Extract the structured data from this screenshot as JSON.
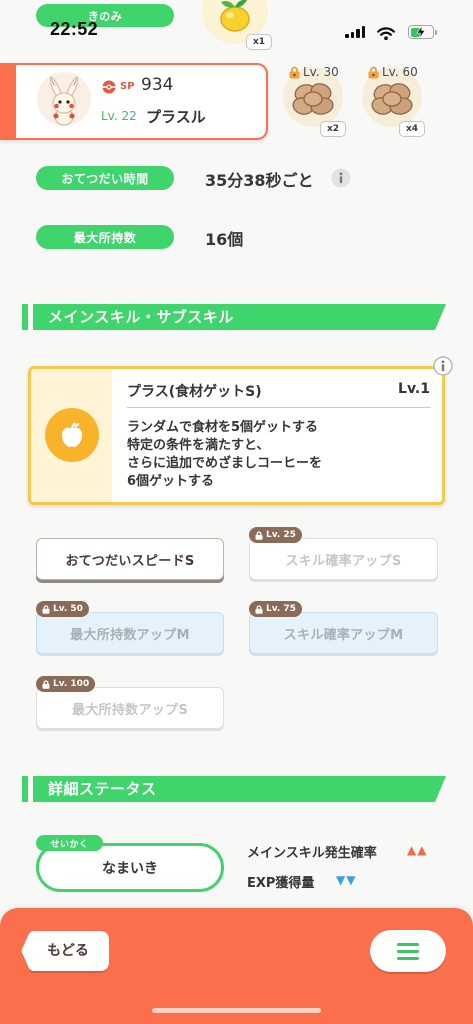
{
  "colors": {
    "green": "#3fd46c",
    "coral": "#fb6f4c",
    "skill_border": "#f5c84a",
    "lock_tag": "#8b6a57",
    "up_arrow": "#f26b46",
    "down_arrow": "#3aa0e6",
    "level_green": "#3dbd60"
  },
  "status_bar": {
    "time": "22:52",
    "signal_bars": 4,
    "wifi_icon": "wifi-icon",
    "battery": {
      "level": 0.45,
      "charging": true
    }
  },
  "berry": {
    "label": "きのみ",
    "icon": "berry-icon",
    "count": "x1"
  },
  "pokemon": {
    "avatar_icon": "pokemon-avatar-icon",
    "sp_label": "SP",
    "sp_value": "934",
    "level": "Lv. 22",
    "name": "プラスル"
  },
  "ingredients": [
    {
      "unlock_level": "Lv. 30",
      "count": "x2",
      "icon": "ingredient-icon"
    },
    {
      "unlock_level": "Lv. 60",
      "count": "x4",
      "icon": "ingredient-icon"
    }
  ],
  "stats": [
    {
      "label": "おてつだい時間",
      "value": "35分38秒ごと"
    },
    {
      "label": "最大所持数",
      "value": "16個"
    }
  ],
  "skills_section": {
    "title": "メインスキル・サブスキル",
    "main_skill": {
      "name": "プラス(食材ゲットS)",
      "level": "Lv.1",
      "icon": "apple-icon",
      "description": [
        "ランダムで食材を5個ゲットする",
        "特定の条件を満たすと、",
        "さらに追加でめざましコーヒーを",
        "6個ゲットする"
      ]
    },
    "sub_skills": [
      {
        "name": "おてつだいスピードS"
      },
      {
        "name": "スキル確率アップS",
        "unlock_level": "Lv. 25"
      },
      {
        "name": "最大所持数アップM",
        "unlock_level": "Lv. 50"
      },
      {
        "name": "スキル確率アップM",
        "unlock_level": "Lv. 75"
      },
      {
        "name": "最大所持数アップS",
        "unlock_level": "Lv. 100"
      }
    ]
  },
  "status_section": {
    "title": "詳細ステータス",
    "nature": {
      "label": "せいかく",
      "value": "なまいき"
    },
    "effects": [
      {
        "label": "メインスキル発生確率",
        "arrows": "▲▲"
      },
      {
        "label": "EXP獲得量",
        "arrows": "▼▼"
      }
    ]
  },
  "footer": {
    "back_label": "もどる",
    "menu_icon": "menu-icon"
  }
}
